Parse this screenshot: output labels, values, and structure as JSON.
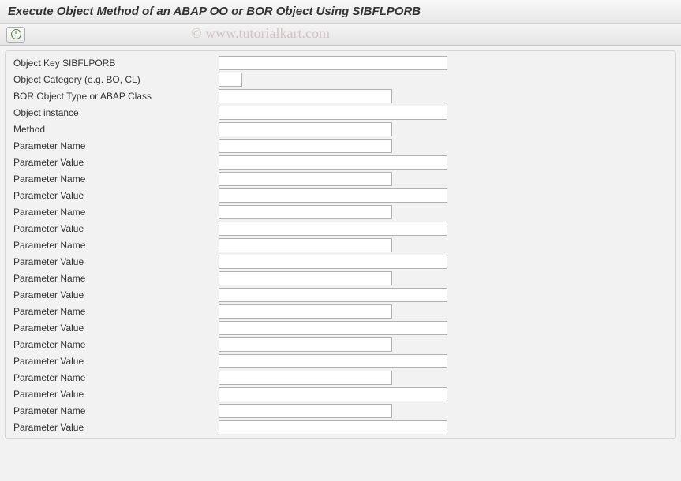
{
  "title": "Execute Object Method of an ABAP OO or BOR Object Using SIBFLPORB",
  "watermark": "© www.tutorialkart.com",
  "toolbar": {
    "execute_icon": "clock-icon"
  },
  "fields": [
    {
      "label": "Object Key SIBFLPORB",
      "size": "xl",
      "name": "object-key"
    },
    {
      "label": "Object Category (e.g. BO, CL)",
      "size": "xs",
      "name": "object-category"
    },
    {
      "label": "BOR Object Type or ABAP Class",
      "size": "m",
      "name": "bor-object-type"
    },
    {
      "label": "Object instance",
      "size": "xl",
      "name": "object-instance"
    },
    {
      "label": "Method",
      "size": "m",
      "name": "method"
    },
    {
      "label": "Parameter Name",
      "size": "m",
      "name": "parameter-name-1"
    },
    {
      "label": "Parameter Value",
      "size": "xl",
      "name": "parameter-value-1"
    },
    {
      "label": "Parameter Name",
      "size": "m",
      "name": "parameter-name-2"
    },
    {
      "label": "Parameter Value",
      "size": "xl",
      "name": "parameter-value-2"
    },
    {
      "label": "Parameter Name",
      "size": "m",
      "name": "parameter-name-3"
    },
    {
      "label": "Parameter Value",
      "size": "xl",
      "name": "parameter-value-3"
    },
    {
      "label": "Parameter Name",
      "size": "m",
      "name": "parameter-name-4"
    },
    {
      "label": "Parameter Value",
      "size": "xl",
      "name": "parameter-value-4"
    },
    {
      "label": "Parameter Name",
      "size": "m",
      "name": "parameter-name-5"
    },
    {
      "label": "Parameter Value",
      "size": "xl",
      "name": "parameter-value-5"
    },
    {
      "label": "Parameter Name",
      "size": "m",
      "name": "parameter-name-6"
    },
    {
      "label": "Parameter Value",
      "size": "xl",
      "name": "parameter-value-6"
    },
    {
      "label": "Parameter Name",
      "size": "m",
      "name": "parameter-name-7"
    },
    {
      "label": "Parameter Value",
      "size": "xl",
      "name": "parameter-value-7"
    },
    {
      "label": "Parameter Name",
      "size": "m",
      "name": "parameter-name-8"
    },
    {
      "label": "Parameter Value",
      "size": "xl",
      "name": "parameter-value-8"
    },
    {
      "label": "Parameter Name",
      "size": "m",
      "name": "parameter-name-9"
    },
    {
      "label": "Parameter Value",
      "size": "xl",
      "name": "parameter-value-9"
    }
  ]
}
